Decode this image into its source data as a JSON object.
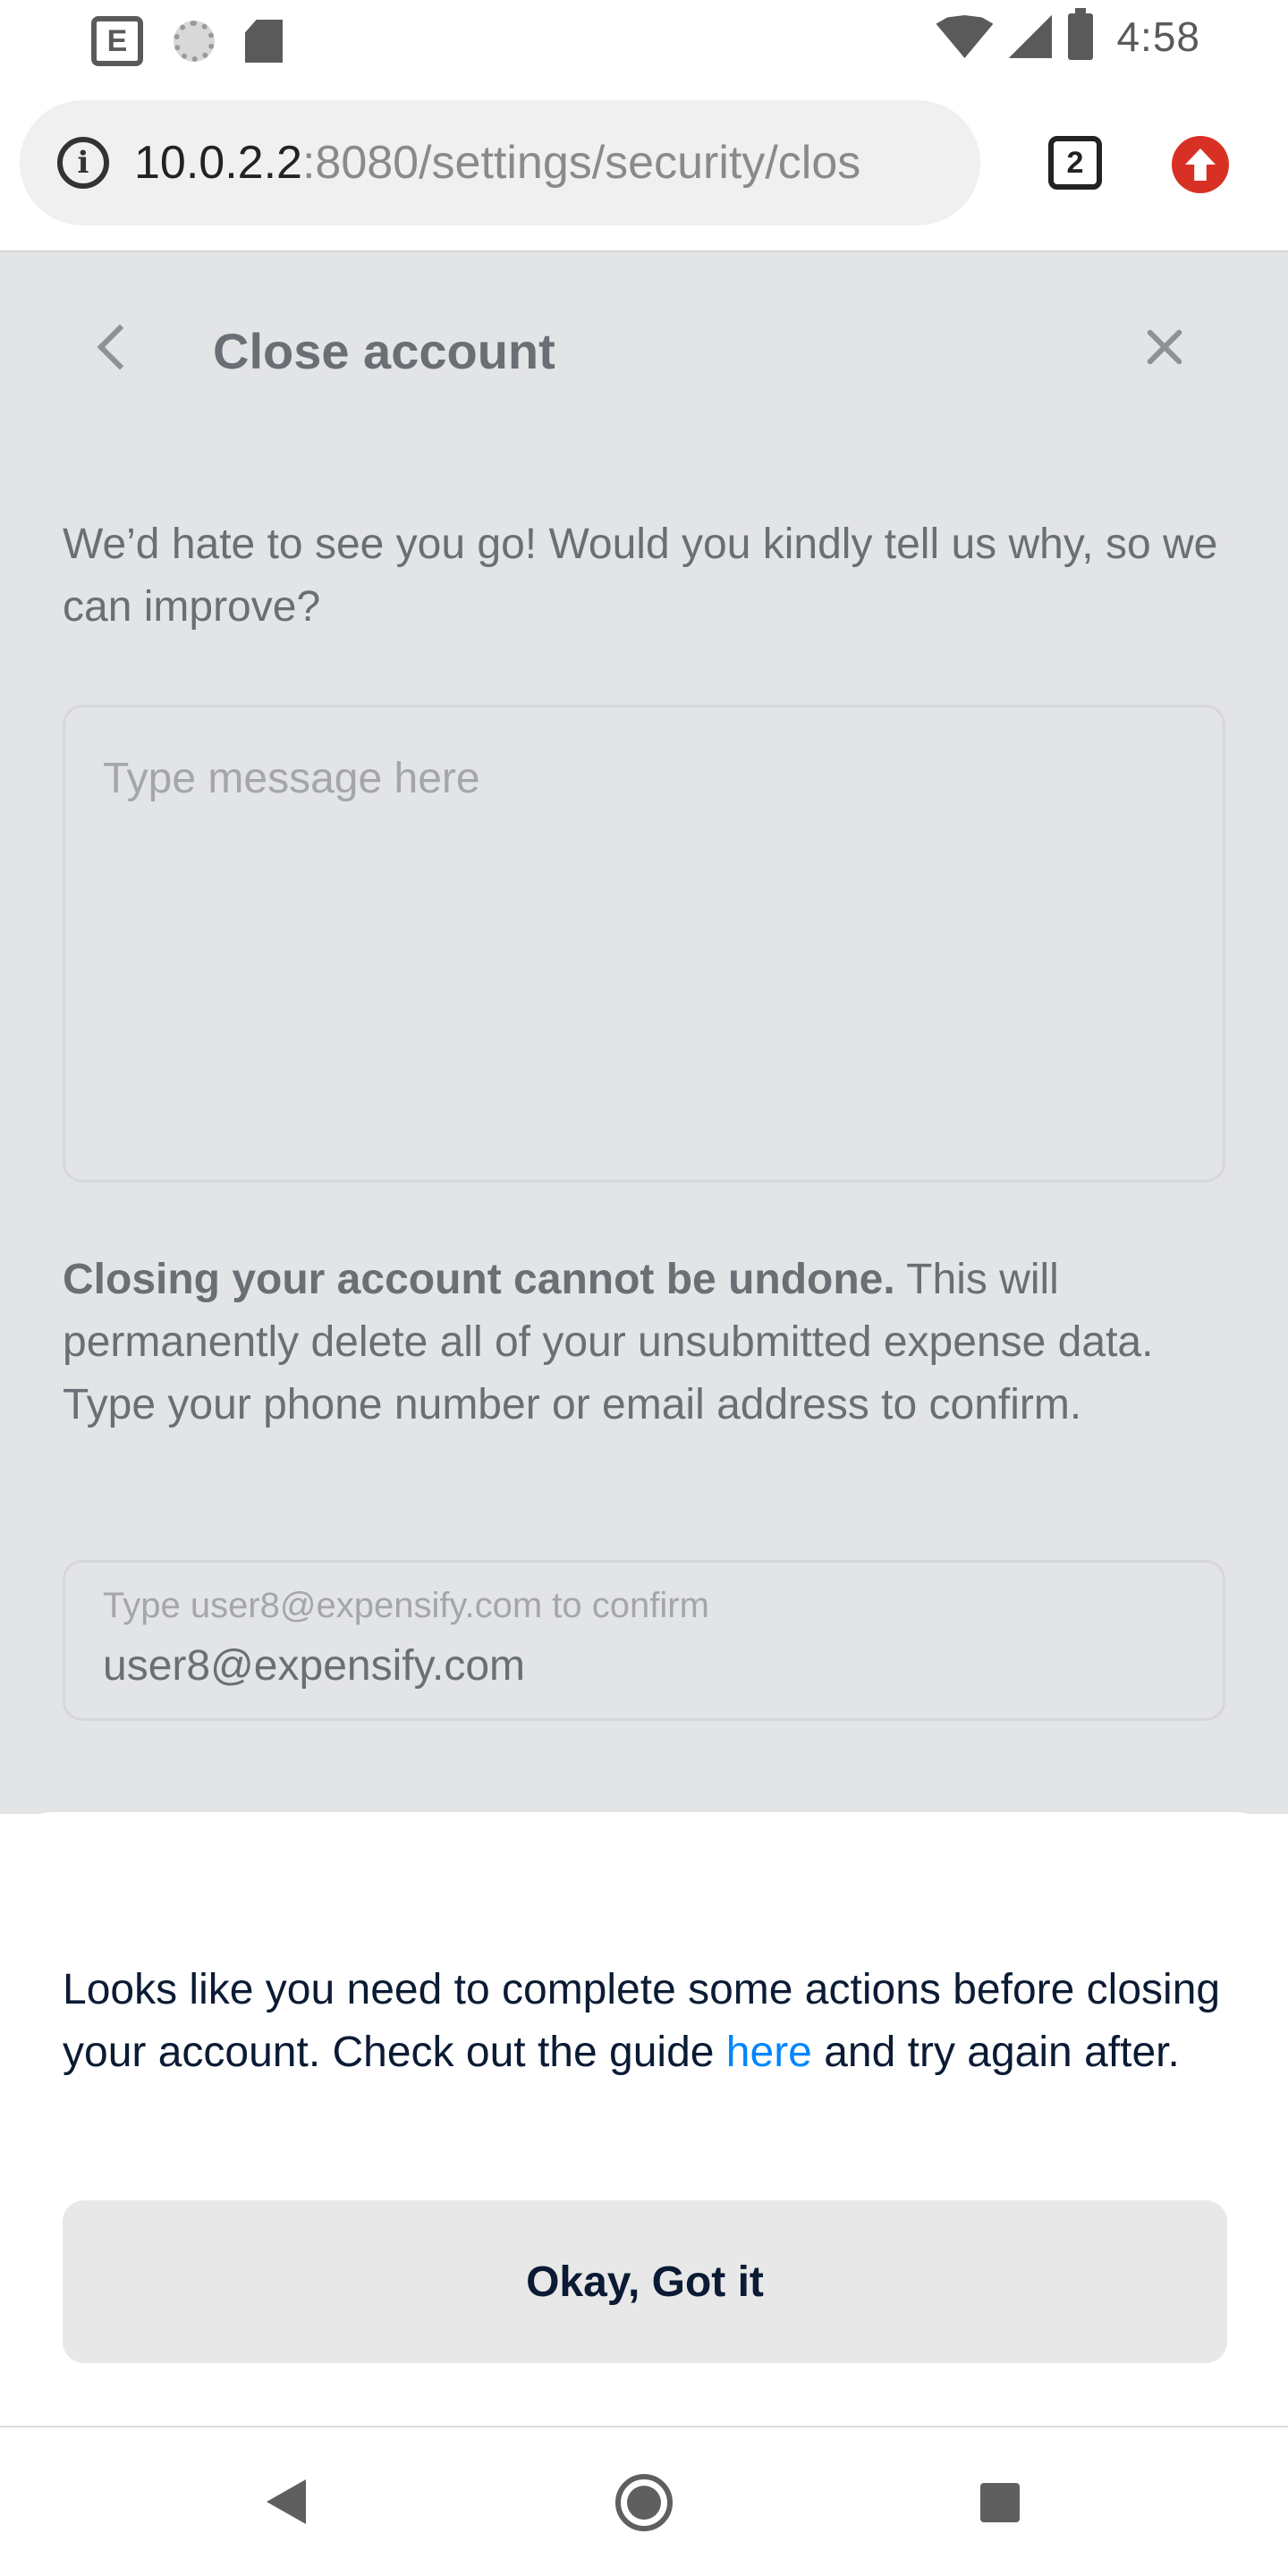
{
  "status_bar": {
    "time": "4:58",
    "left_icons": [
      "expensify-notification-icon",
      "loading-icon",
      "sd-card-icon"
    ],
    "right_icons": [
      "wifi-icon",
      "signal-icon",
      "battery-icon"
    ]
  },
  "browser": {
    "url_host": "10.0.2.2",
    "url_path": ":8080/settings/security/clos",
    "tab_count": "2"
  },
  "page": {
    "title": "Close account",
    "prompt": "We’d hate to see you go! Would you kindly tell us why, so we can improve?",
    "message_placeholder": "Type message here",
    "warning_bold": "Closing your account cannot be undone.",
    "warning_rest": " This will permanently delete all of your unsubmitted expense data. Type your phone number or email address to confirm.",
    "confirm_label": "Type user8@expensify.com to confirm",
    "confirm_value": "user8@expensify.com"
  },
  "sheet": {
    "text_before": "Looks like you need to complete some actions before closing your account. Check out the guide ",
    "link_text": "here",
    "text_after": " and try again after.",
    "button_label": "Okay, Got it"
  },
  "colors": {
    "overlay_bg": "#e3e4e6",
    "link": "#0185ff",
    "text_dark": "#0b1b34",
    "update_badge": "#d93025"
  }
}
